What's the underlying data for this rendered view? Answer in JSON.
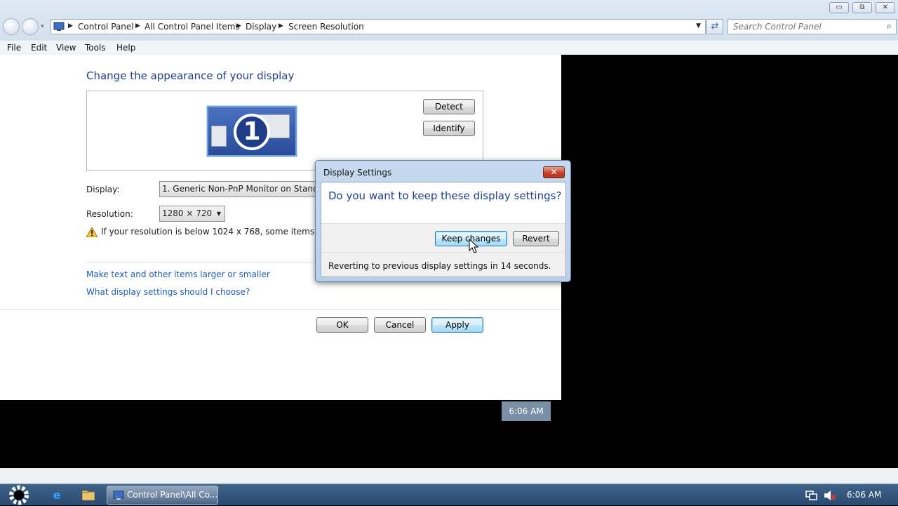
{
  "window": {
    "controls": {
      "minimize": "▭",
      "maximize": "⧉",
      "close": "✕"
    },
    "breadcrumb": [
      "Control Panel",
      "All Control Panel Items",
      "Display",
      "Screen Resolution"
    ],
    "search_placeholder": "Search Control Panel",
    "menu": [
      "File",
      "Edit",
      "View",
      "Tools",
      "Help"
    ]
  },
  "main": {
    "heading": "Change the appearance of your display",
    "monitor_number": "1",
    "detect_label": "Detect",
    "identify_label": "Identify",
    "display_label": "Display:",
    "display_value": "1. Generic Non-PnP Monitor on Standard",
    "resolution_label": "Resolution:",
    "resolution_value": "1280 × 720",
    "warning_text": "If your resolution is below 1024 x 768, some items may not",
    "links": [
      "Make text and other items larger or smaller",
      "What display settings should I choose?"
    ],
    "ok_label": "OK",
    "cancel_label": "Cancel",
    "apply_label": "Apply"
  },
  "dialog": {
    "title": "Display Settings",
    "question": "Do you want to keep these display settings?",
    "keep_label": "Keep changes",
    "revert_label": "Revert",
    "status": "Reverting to previous display settings in 14 seconds."
  },
  "desktop_clock": "6:06 AM",
  "taskbar": {
    "task_label": "Control Panel\\All Co...",
    "tray_time": "6:06 AM"
  },
  "colors": {
    "heading": "#1e3f8c",
    "link": "#1e5cb3",
    "taskbar": "#2a4a70"
  }
}
